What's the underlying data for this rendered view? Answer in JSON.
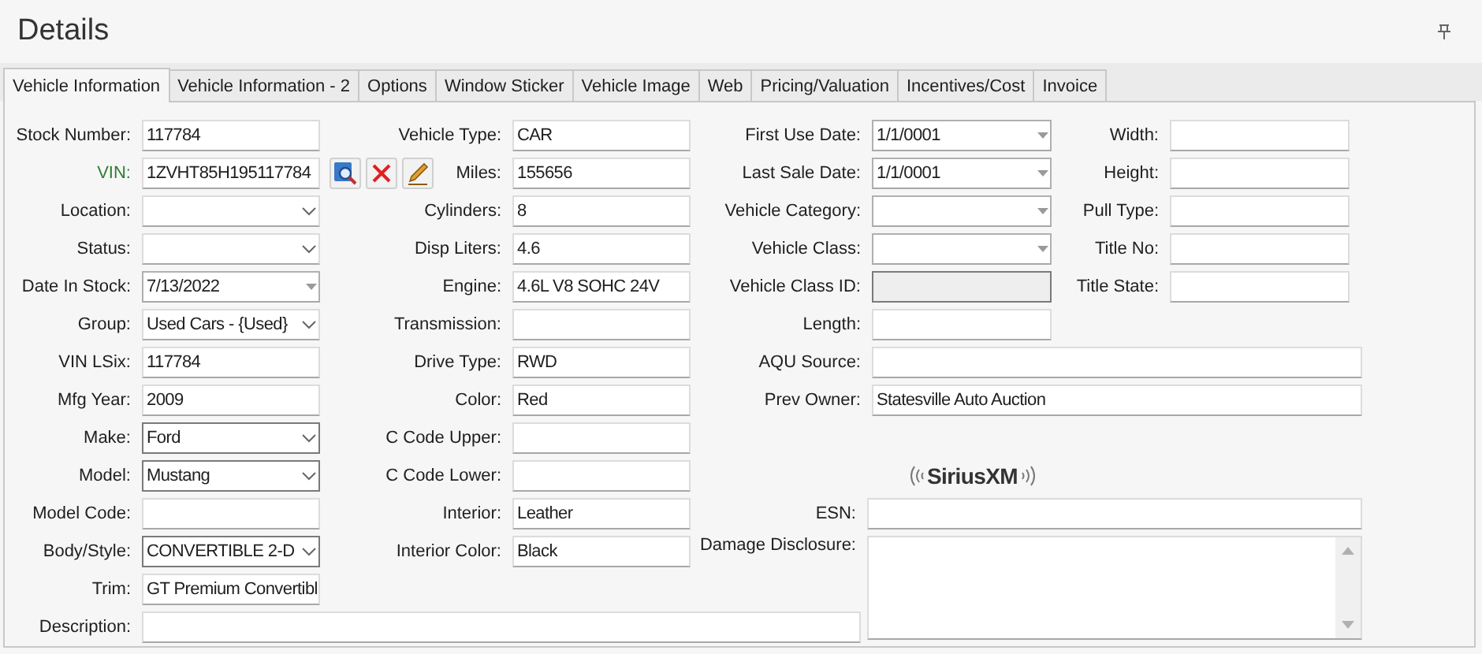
{
  "title": "Details",
  "tabs": [
    {
      "label": "Vehicle Information",
      "selected": true
    },
    {
      "label": "Vehicle Information - 2",
      "selected": false
    },
    {
      "label": "Options",
      "selected": false
    },
    {
      "label": "Window Sticker",
      "selected": false
    },
    {
      "label": "Vehicle Image",
      "selected": false
    },
    {
      "label": "Web",
      "selected": false
    },
    {
      "label": "Pricing/Valuation",
      "selected": false
    },
    {
      "label": "Incentives/Cost",
      "selected": false
    },
    {
      "label": "Invoice",
      "selected": false
    }
  ],
  "column_1": [
    {
      "label": "Stock Number:",
      "kind": "text",
      "value": "117784"
    },
    {
      "label": "VIN:",
      "kind": "vin",
      "value": "1ZVHT85H195117784",
      "highlighted": true
    },
    {
      "label": "Location:",
      "kind": "dropdown"
    },
    {
      "label": "Status:",
      "kind": "dropdown"
    },
    {
      "label": "Date In Stock:",
      "kind": "date",
      "value": "7/13/2022"
    },
    {
      "label": "Group:",
      "kind": "dropdown",
      "value": "Used Cars - {Used}"
    },
    {
      "label": "VIN LSix:",
      "kind": "text",
      "value": "117784"
    },
    {
      "label": "Mfg Year:",
      "kind": "text",
      "value": "2009"
    },
    {
      "label": "Make:",
      "kind": "dropdown",
      "value": "Ford",
      "focused": true
    },
    {
      "label": "Model:",
      "kind": "dropdown",
      "value": "Mustang",
      "focused": true
    },
    {
      "label": "Model Code:",
      "kind": "text"
    },
    {
      "label": "Body/Style:",
      "kind": "dropdown",
      "value": "CONVERTIBLE 2-D",
      "focused": true
    },
    {
      "label": "Trim:",
      "kind": "text",
      "value": "GT Premium Convertibl"
    }
  ],
  "column_2": [
    {
      "label": "Vehicle Type:",
      "kind": "text",
      "value": "CAR"
    },
    {
      "label": "Miles:",
      "kind": "text",
      "value": "155656"
    },
    {
      "label": "Cylinders:",
      "kind": "text",
      "value": "8"
    },
    {
      "label": "Disp Liters:",
      "kind": "text",
      "value": "4.6"
    },
    {
      "label": "Engine:",
      "kind": "text",
      "value": "4.6L V8 SOHC 24V"
    },
    {
      "label": "Transmission:",
      "kind": "text"
    },
    {
      "label": "Drive Type:",
      "kind": "text",
      "value": "RWD"
    },
    {
      "label": "Color:",
      "kind": "text",
      "value": "Red"
    },
    {
      "label": "C Code Upper:",
      "kind": "text"
    },
    {
      "label": "C Code Lower:",
      "kind": "text"
    },
    {
      "label": "Interior:",
      "kind": "text",
      "value": "Leather"
    },
    {
      "label": "Interior Color:",
      "kind": "text",
      "value": "Black"
    }
  ],
  "description": {
    "label": "Description:"
  },
  "column_3": [
    {
      "label": "First Use Date:",
      "kind": "date",
      "value": "1/1/0001"
    },
    {
      "label": "Last Sale Date:",
      "kind": "date",
      "value": "1/1/0001"
    },
    {
      "label": "Vehicle Category:",
      "kind": "date"
    },
    {
      "label": "Vehicle Class:",
      "kind": "date"
    },
    {
      "label": "Vehicle Class ID:",
      "kind": "readonly"
    },
    {
      "label": "Length:",
      "kind": "text"
    }
  ],
  "column_4": [
    {
      "label": "Width:",
      "kind": "text"
    },
    {
      "label": "Height:",
      "kind": "text"
    },
    {
      "label": "Pull Type:",
      "kind": "text"
    },
    {
      "label": "Title No:",
      "kind": "text"
    },
    {
      "label": "Title State:",
      "kind": "text"
    }
  ],
  "wide_fields": [
    {
      "label": "AQU Source:",
      "kind": "text"
    },
    {
      "label": "Prev Owner:",
      "kind": "text",
      "value": "Statesville Auto Auction"
    }
  ],
  "logo": "SiriusXM",
  "esn": {
    "label": "ESN:"
  },
  "damage_disclosure": {
    "label": "Damage Disclosure:"
  }
}
